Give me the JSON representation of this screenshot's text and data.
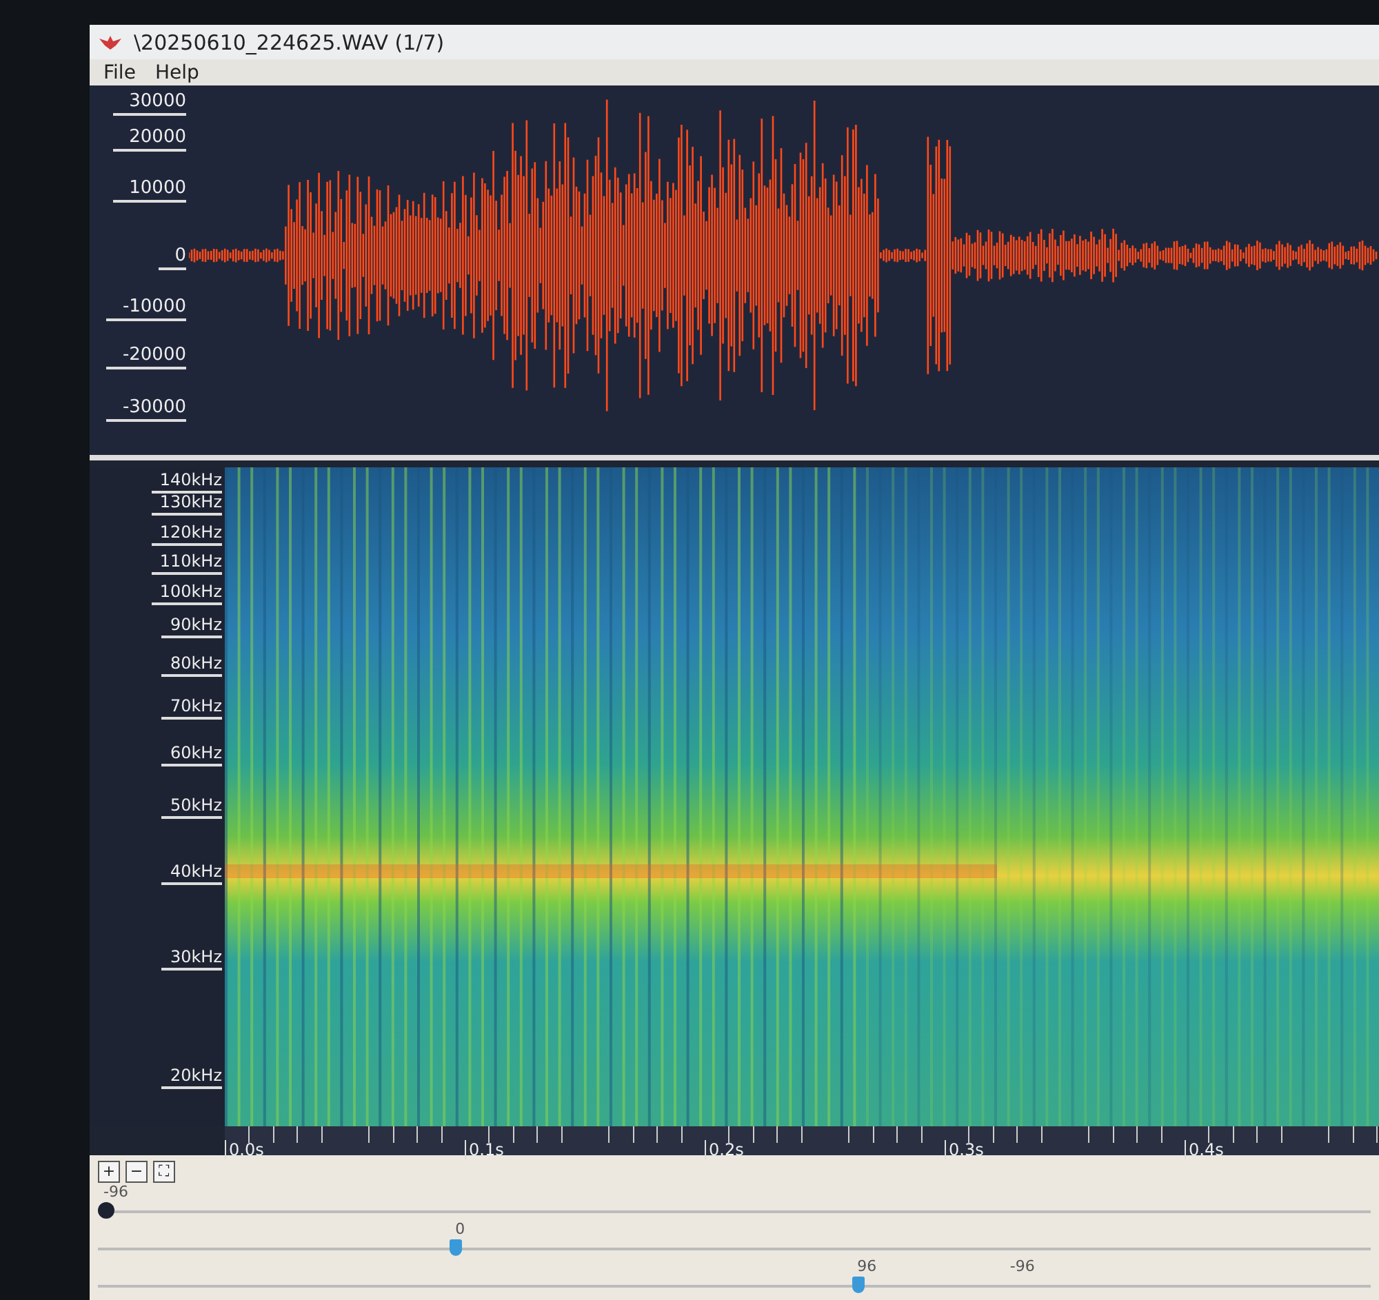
{
  "window": {
    "title": "\\20250610_224625.WAV (1/7)"
  },
  "menu": [
    "File",
    "Help"
  ],
  "waveform": {
    "y_labels": [
      "30000",
      "20000",
      "10000",
      "0",
      "-10000",
      "-20000",
      "-30000"
    ]
  },
  "spectrogram": {
    "y_labels": [
      "140kHz",
      "130kHz",
      "120kHz",
      "110kHz",
      "100kHz",
      "90kHz",
      "80kHz",
      "70kHz",
      "60kHz",
      "50kHz",
      "40kHz",
      "30kHz",
      "20kHz"
    ]
  },
  "time_axis": {
    "labels": [
      "0.0s",
      "0.1s",
      "0.2s",
      "0.3s",
      "0.4s"
    ]
  },
  "zoom_buttons": [
    "+",
    "−",
    "⛶"
  ],
  "sliders": [
    {
      "labels": [
        "-96"
      ],
      "level": 0
    },
    {
      "labels": [
        "0"
      ],
      "level": 0.28
    },
    {
      "labels": [
        "96",
        "-96"
      ],
      "level": 0.6
    }
  ]
}
